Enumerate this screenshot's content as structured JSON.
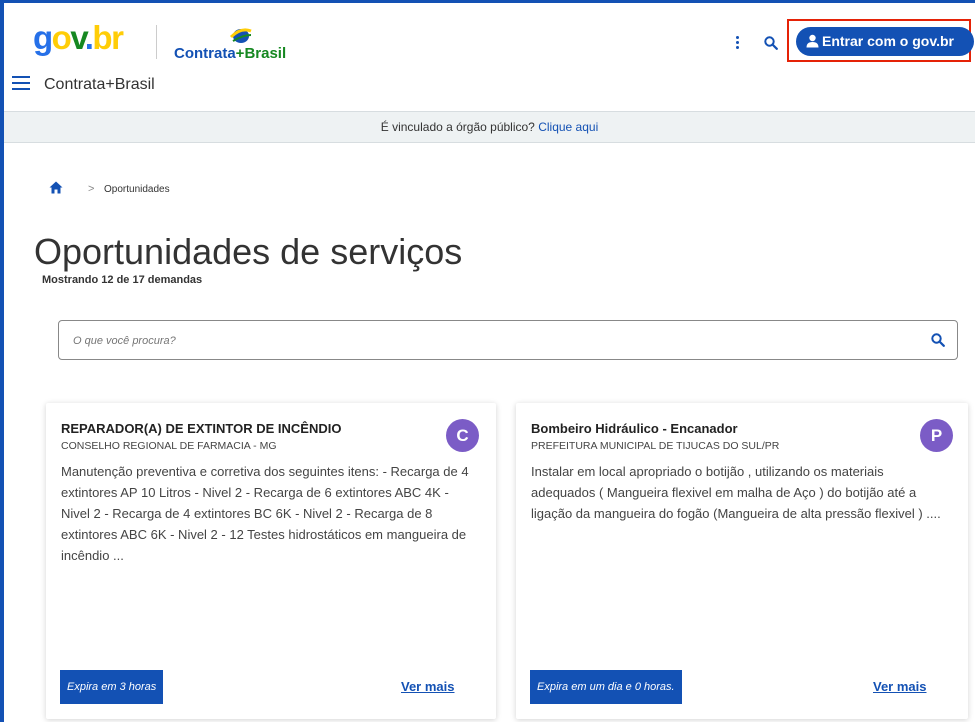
{
  "header": {
    "logo_gov": {
      "g": "g",
      "o": "o",
      "v": "v",
      "dot": ".",
      "br": "br"
    },
    "logo_contrata": {
      "part1": "Contrata",
      "plus": "+",
      "part2": "Brasil"
    },
    "site_name": "Contrata+Brasil",
    "login_label": "Entrar com o gov.br",
    "icons": {
      "menu": "hamburger-menu-icon",
      "kebab": "kebab-menu-icon",
      "search": "search-icon",
      "user": "user-icon"
    }
  },
  "notice": {
    "text": "É vinculado a órgão público? ",
    "link": "Clique aqui"
  },
  "breadcrumb": {
    "separator": ">",
    "current": "Oportunidades"
  },
  "page": {
    "title": "Oportunidades de serviços",
    "subtitle": "Mostrando 12 de 17 demandas"
  },
  "search": {
    "placeholder": "O que você procura?"
  },
  "cards": [
    {
      "title": "REPARADOR(A) DE EXTINTOR DE INCÊNDIO",
      "org": "CONSELHO REGIONAL DE FARMACIA - MG",
      "avatar": "C",
      "description": "Manutenção preventiva e corretiva dos seguintes itens: - Recarga de 4 extintores AP 10 Litros - Nivel 2 - Recarga de 6 extintores ABC 4K - Nivel 2 - Recarga de 4 extintores BC 6K - Nivel 2 - Recarga de 8 extintores ABC 6K - Nivel 2 - 12 Testes hidrostáticos em mangueira de incêndio ...",
      "expire": "Expira em 3 horas",
      "more": "Ver mais"
    },
    {
      "title": "Bombeiro Hidráulico - Encanador",
      "org": "PREFEITURA MUNICIPAL DE TIJUCAS DO SUL/PR",
      "avatar": "P",
      "description": "Instalar em local apropriado o botijão , utilizando os materiais adequados ( Mangueira flexivel em malha de Aço ) do botijão até a ligação da mangueira do fogão (Mangueira de alta pressão flexivel ) ....",
      "expire": "Expira em um dia e 0 horas.",
      "more": "Ver mais"
    }
  ],
  "colors": {
    "primary": "#1351b4",
    "highlight_outline": "#e52207",
    "avatar": "#7b5cc6",
    "notice_bg": "#eef2f3"
  }
}
